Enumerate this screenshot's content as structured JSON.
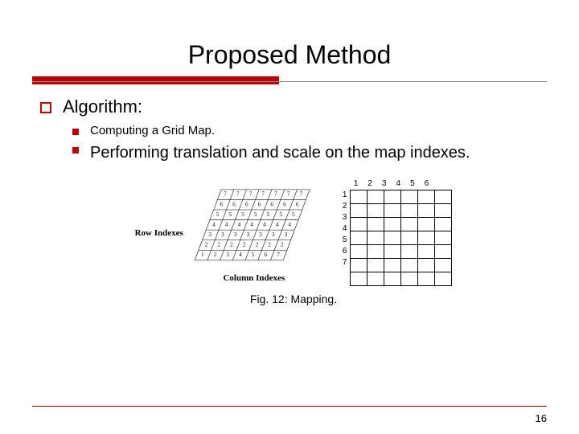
{
  "title": "Proposed Method",
  "lvl1": {
    "text": "Algorithm:"
  },
  "lvl2a": {
    "text": "Computing a Grid Map."
  },
  "lvl2b": {
    "text": "Performing translation and scale on the map indexes."
  },
  "figure": {
    "row_label": "Row Indexes",
    "col_label": "Column Indexes",
    "skew_rows": [
      [
        7,
        7,
        7,
        7,
        7,
        7,
        7
      ],
      [
        6,
        6,
        6,
        6,
        6,
        6,
        6
      ],
      [
        5,
        5,
        5,
        5,
        5,
        5,
        5
      ],
      [
        4,
        4,
        4,
        4,
        4,
        4,
        4
      ],
      [
        3,
        3,
        3,
        3,
        3,
        3,
        3
      ],
      [
        2,
        2,
        2,
        2,
        2,
        2,
        2
      ],
      [
        1,
        2,
        3,
        4,
        5,
        6,
        7
      ]
    ],
    "right_cols": [
      "1",
      "2",
      "3",
      "4",
      "5",
      "6"
    ],
    "right_rows": [
      "1",
      "2",
      "3",
      "4",
      "5",
      "6",
      "7"
    ],
    "caption": "Fig. 12: Mapping."
  },
  "page_number": "16"
}
